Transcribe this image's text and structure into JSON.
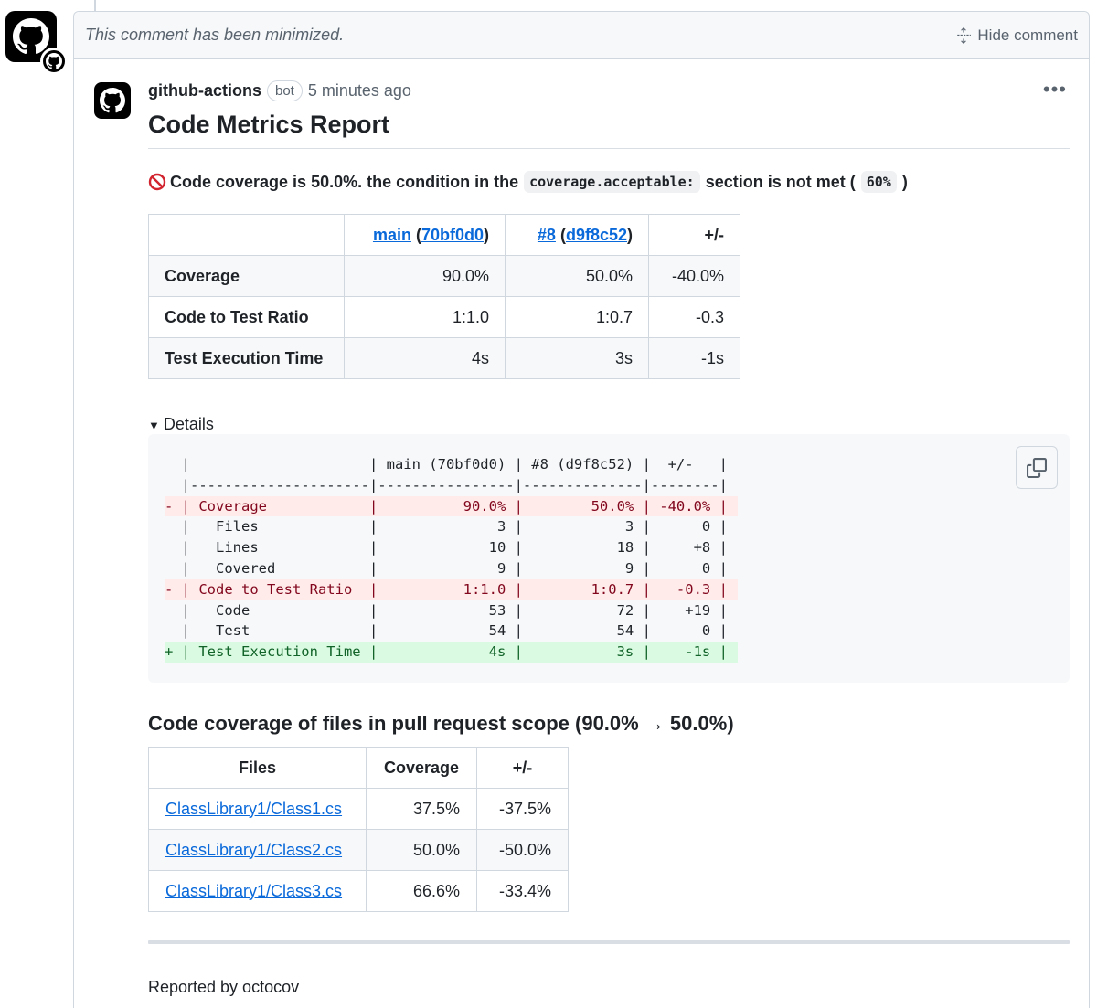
{
  "minimized": {
    "text": "This comment has been minimized.",
    "hide_label": "Hide comment"
  },
  "comment": {
    "author": "github-actions",
    "badge": "bot",
    "time": "5 minutes ago",
    "more": "•••",
    "title": "Code Metrics Report"
  },
  "condition": {
    "text1": "Code coverage is 50.0%. the condition in the",
    "code1": "coverage.acceptable:",
    "text2": "section is not met (",
    "code2": "60%",
    "text3": ")"
  },
  "metrics_table": {
    "header_col2_link1": "main",
    "header_col2_paren_open": " (",
    "header_col2_link2": "70bf0d0",
    "header_col2_paren_close": ")",
    "header_col3_link1": "#8",
    "header_col3_paren_open": " (",
    "header_col3_link2": "d9f8c52",
    "header_col3_paren_close": ")",
    "header_col4": "+/-",
    "rows": [
      {
        "label": "Coverage",
        "main": "90.0%",
        "pr": "50.0%",
        "diff": "-40.0%"
      },
      {
        "label": "Code to Test Ratio",
        "main": "1:1.0",
        "pr": "1:0.7",
        "diff": "-0.3"
      },
      {
        "label": "Test Execution Time",
        "main": "4s",
        "pr": "3s",
        "diff": "-1s"
      }
    ]
  },
  "details": {
    "toggle": "▼",
    "label": "Details",
    "lines": [
      "  |                     | main (70bf0d0) | #8 (d9f8c52) |  +/-   |",
      "  |---------------------|----------------|--------------|--------|",
      "- | Coverage            |          90.0% |        50.0% | -40.0% |",
      "  |   Files             |              3 |            3 |      0 |",
      "  |   Lines             |             10 |           18 |     +8 |",
      "  |   Covered           |              9 |            9 |      0 |",
      "- | Code to Test Ratio  |          1:1.0 |        1:0.7 |   -0.3 |",
      "  |   Code              |             53 |           72 |    +19 |",
      "  |   Test              |             54 |           54 |      0 |",
      "+ | Test Execution Time |             4s |           3s |    -1s |"
    ]
  },
  "files_section": {
    "title": "Code coverage of files in pull request scope (90.0% → 50.0%)",
    "headers": [
      "Files",
      "Coverage",
      "+/-"
    ],
    "rows": [
      {
        "file": "ClassLibrary1/Class1.cs",
        "coverage": "37.5%",
        "diff": "-37.5%"
      },
      {
        "file": "ClassLibrary1/Class2.cs",
        "coverage": "50.0%",
        "diff": "-50.0%"
      },
      {
        "file": "ClassLibrary1/Class3.cs",
        "coverage": "66.6%",
        "diff": "-33.4%"
      }
    ]
  },
  "footer": {
    "reported": "Reported by octocov"
  }
}
